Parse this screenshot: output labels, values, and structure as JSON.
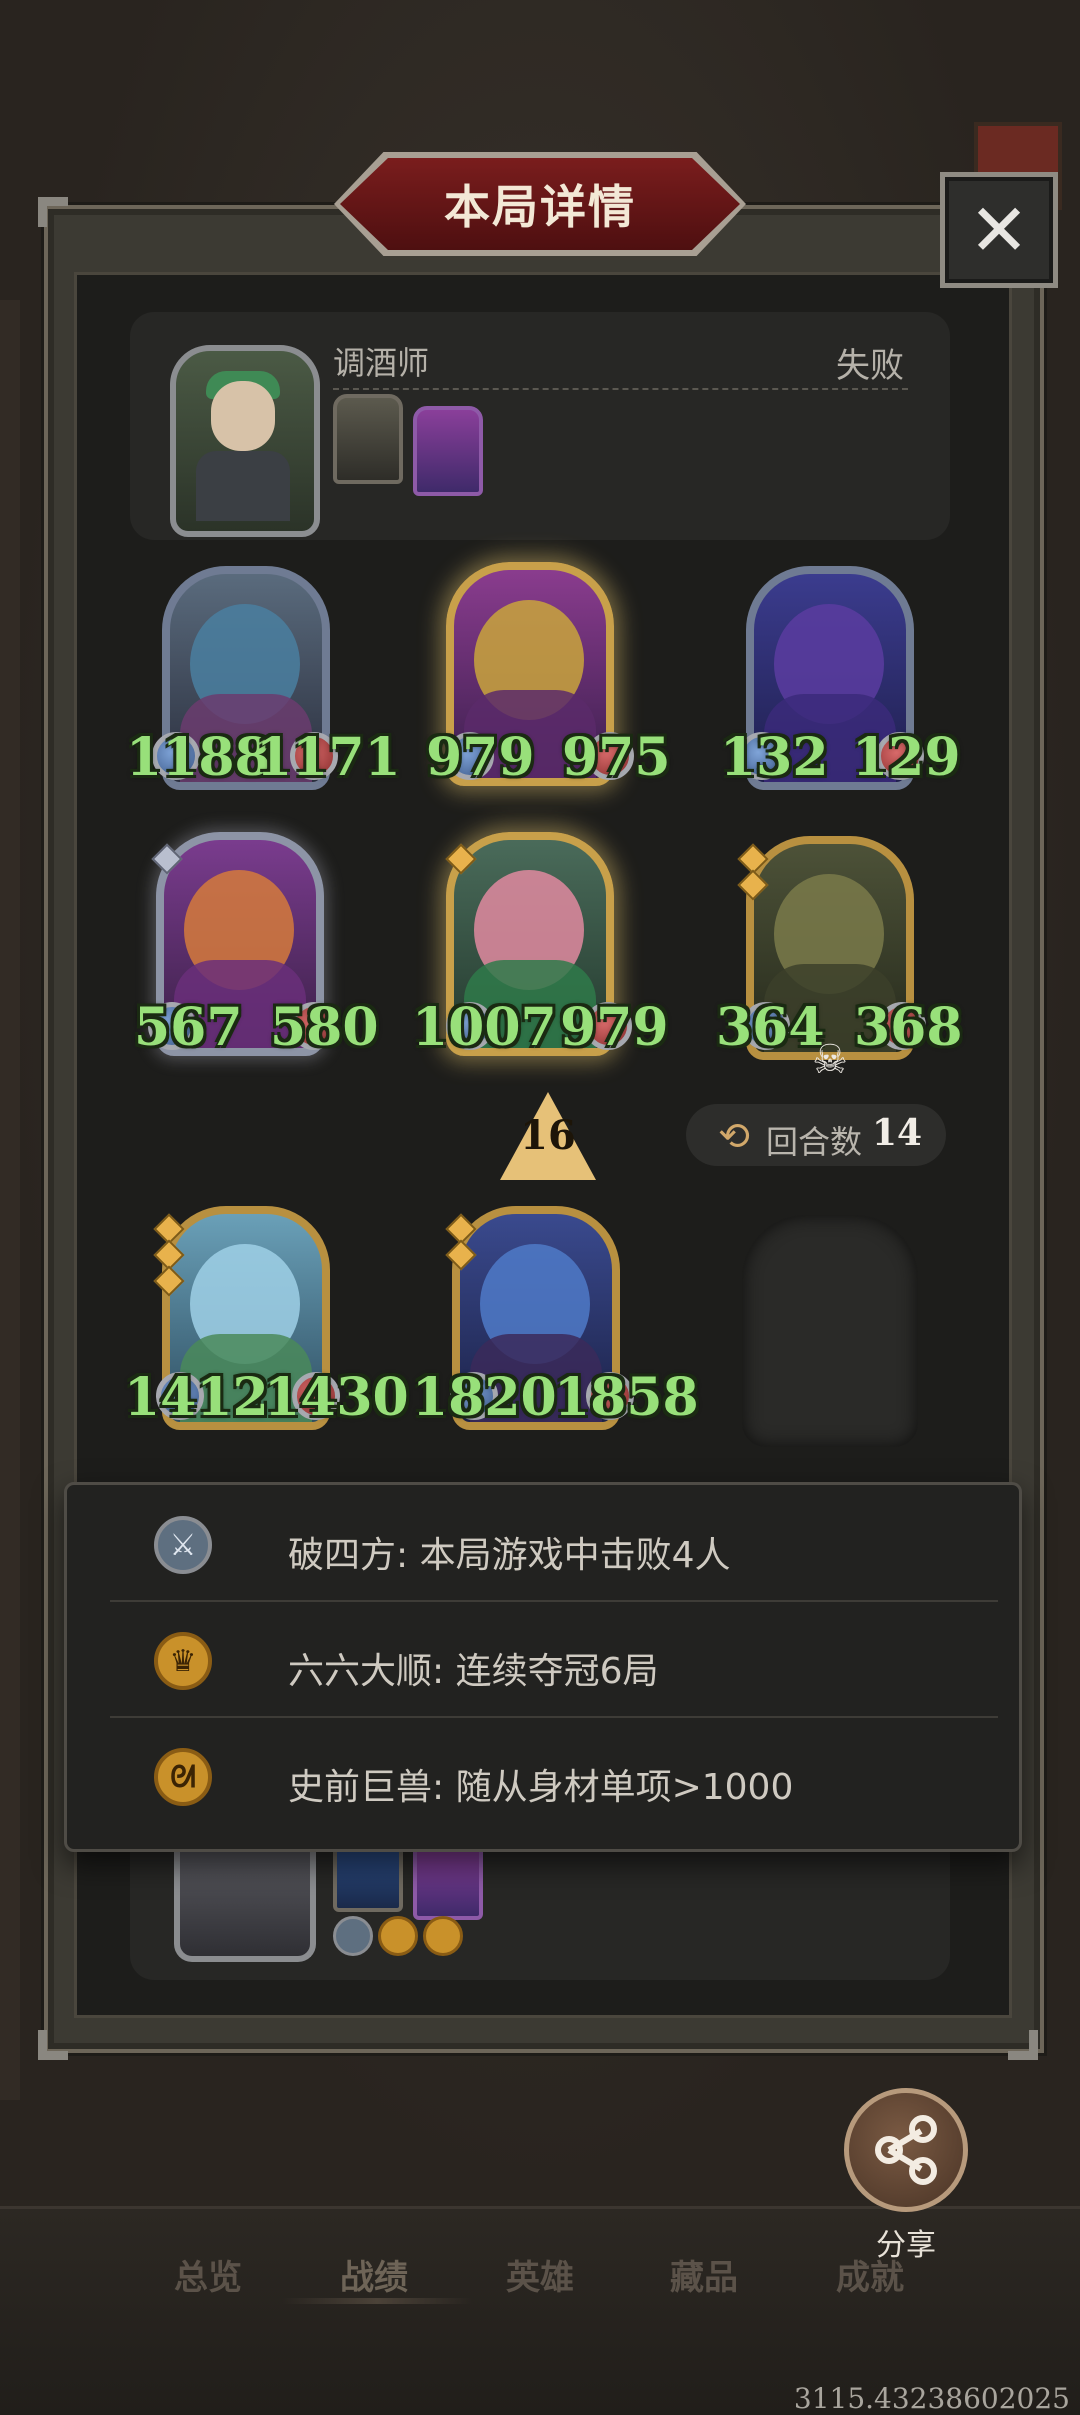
{
  "header": {
    "title": "本局详情",
    "close_glyph": "✕"
  },
  "player": {
    "name": "调酒师",
    "result": "失败"
  },
  "minions_row1": [
    {
      "attack": "1188",
      "health": "1171"
    },
    {
      "attack": "979",
      "health": "975"
    },
    {
      "attack": "132",
      "health": "129"
    }
  ],
  "minions_row2": [
    {
      "attack": "567",
      "health": "580"
    },
    {
      "attack": "1007",
      "health": "979"
    },
    {
      "attack": "364",
      "health": "368"
    }
  ],
  "minions_row3": [
    {
      "attack": "1412",
      "health": "1430"
    },
    {
      "attack": "1820",
      "health": "1858"
    }
  ],
  "upgrade": {
    "level": "16"
  },
  "turns": {
    "label": "回合数",
    "value": "14"
  },
  "achievements": [
    {
      "icon": "swords-icon",
      "text": "破四方: 本局游戏中击败4人"
    },
    {
      "icon": "crown-icon",
      "text": "六六大顺: 连续夺冠6局"
    },
    {
      "icon": "claw-icon",
      "text": "史前巨兽: 随从身材单项>1000"
    }
  ],
  "share": {
    "label": "分享"
  },
  "tabs": [
    "总览",
    "战绩",
    "英雄",
    "藏品",
    "成就"
  ],
  "active_tab": "战绩",
  "version": "3115.43238602025",
  "colors": {
    "stat_green": "#98e07a",
    "title_red": "#7a1d1d",
    "panel_dark": "#1d1d1b"
  }
}
